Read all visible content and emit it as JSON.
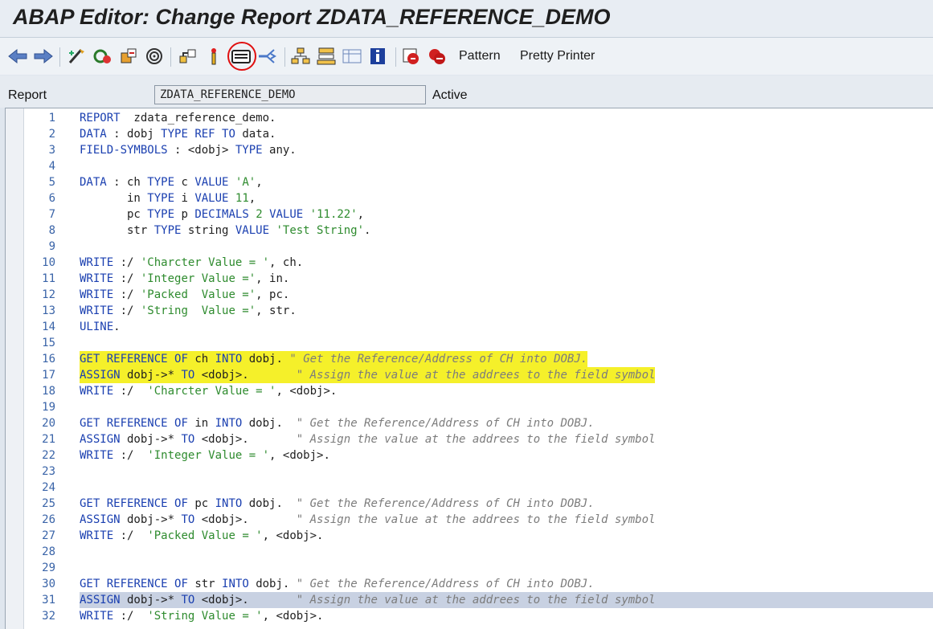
{
  "title": "ABAP Editor: Change Report ZDATA_REFERENCE_DEMO",
  "toolbar": {
    "pattern_label": "Pattern",
    "pretty_printer_label": "Pretty Printer",
    "icons": [
      "back-arrow-icon",
      "forward-arrow-icon",
      "other-object-icon",
      "display-change-icon",
      "active-inactive-icon",
      "check-icon",
      "activate-icon",
      "test-icon",
      "where-used-icon",
      "mark-line-icon",
      "insert-statement-icon",
      "navigation-window-icon",
      "object-list-icon",
      "display-object-list-icon",
      "dictionary-icon",
      "info-icon",
      "breakpoint-session-icon",
      "breakpoint-external-icon"
    ]
  },
  "field": {
    "label": "Report",
    "value": "ZDATA_REFERENCE_DEMO",
    "status": "Active"
  },
  "editor": {
    "lines": [
      {
        "n": "1",
        "t": "REPORT  zdata_reference_demo."
      },
      {
        "n": "2",
        "t": "DATA : dobj TYPE REF TO data."
      },
      {
        "n": "3",
        "t": "FIELD-SYMBOLS : <dobj> TYPE any."
      },
      {
        "n": "4",
        "t": ""
      },
      {
        "n": "5",
        "t": "DATA : ch TYPE c VALUE 'A',"
      },
      {
        "n": "6",
        "t": "       in TYPE i VALUE 11,"
      },
      {
        "n": "7",
        "t": "       pc TYPE p DECIMALS 2 VALUE '11.22',"
      },
      {
        "n": "8",
        "t": "       str TYPE string VALUE 'Test String'."
      },
      {
        "n": "9",
        "t": ""
      },
      {
        "n": "10",
        "t": "WRITE :/ 'Charcter Value = ', ch."
      },
      {
        "n": "11",
        "t": "WRITE :/ 'Integer Value =', in."
      },
      {
        "n": "12",
        "t": "WRITE :/ 'Packed  Value =', pc."
      },
      {
        "n": "13",
        "t": "WRITE :/ 'String  Value =', str."
      },
      {
        "n": "14",
        "t": "ULINE."
      },
      {
        "n": "15",
        "t": ""
      },
      {
        "n": "16",
        "t": "GET REFERENCE OF ch INTO dobj. \" Get the Reference/Address of CH into DOBJ."
      },
      {
        "n": "17",
        "t": "ASSIGN dobj->* TO <dobj>.       \" Assign the value at the addrees to the field symbol"
      },
      {
        "n": "18",
        "t": "WRITE :/  'Charcter Value = ', <dobj>."
      },
      {
        "n": "19",
        "t": ""
      },
      {
        "n": "20",
        "t": "GET REFERENCE OF in INTO dobj.  \" Get the Reference/Address of CH into DOBJ."
      },
      {
        "n": "21",
        "t": "ASSIGN dobj->* TO <dobj>.       \" Assign the value at the addrees to the field symbol"
      },
      {
        "n": "22",
        "t": "WRITE :/  'Integer Value = ', <dobj>."
      },
      {
        "n": "23",
        "t": ""
      },
      {
        "n": "24",
        "t": ""
      },
      {
        "n": "25",
        "t": "GET REFERENCE OF pc INTO dobj.  \" Get the Reference/Address of CH into DOBJ."
      },
      {
        "n": "26",
        "t": "ASSIGN dobj->* TO <dobj>.       \" Assign the value at the addrees to the field symbol"
      },
      {
        "n": "27",
        "t": "WRITE :/  'Packed Value = ', <dobj>."
      },
      {
        "n": "28",
        "t": ""
      },
      {
        "n": "29",
        "t": ""
      },
      {
        "n": "30",
        "t": "GET REFERENCE OF str INTO dobj. \" Get the Reference/Address of CH into DOBJ."
      },
      {
        "n": "31",
        "t": "ASSIGN dobj->* TO <dobj>.       \" Assign the value at the addrees to the field symbol"
      },
      {
        "n": "32",
        "t": "WRITE :/  'String Value = ', <dobj>."
      }
    ],
    "highlight_color": "#f5f02a",
    "keyword_color": "#1a3fb0",
    "string_color": "#2e8b2e",
    "comment_color": "#7c7c7c"
  }
}
